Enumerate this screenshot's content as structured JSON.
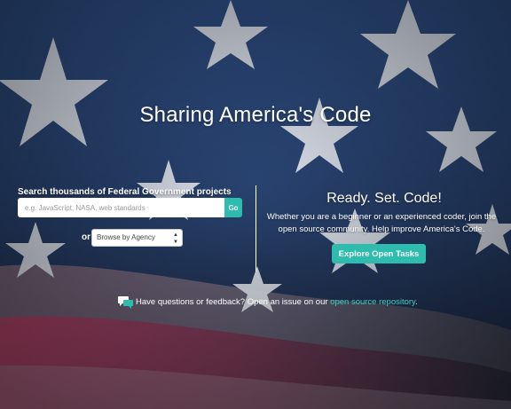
{
  "hero": {
    "title": "Sharing America's Code"
  },
  "search": {
    "label": "Search thousands of Federal Government projects",
    "placeholder": "e.g. JavaScript, NASA, web standards",
    "value": "",
    "go_label": "Go",
    "or_label": "or",
    "agency_selected": "Browse by Agency"
  },
  "ready": {
    "title": "Ready. Set. Code!",
    "text": "Whether you are a beginner or an experienced coder, join the open source community. Help improve America's Code.",
    "button_label": "Explore Open Tasks"
  },
  "feedback": {
    "text": "Have questions or feedback? Open an issue on our ",
    "link_text": "open source repository",
    "trailing": "."
  },
  "icons": {
    "feedback": "chat-bubbles-icon",
    "select": "updown-arrows-icon"
  },
  "colors": {
    "accent": "#2dbcad",
    "link": "#40d0c0",
    "flag_blue": "#2b4a7c",
    "flag_red": "#a23a4e"
  }
}
